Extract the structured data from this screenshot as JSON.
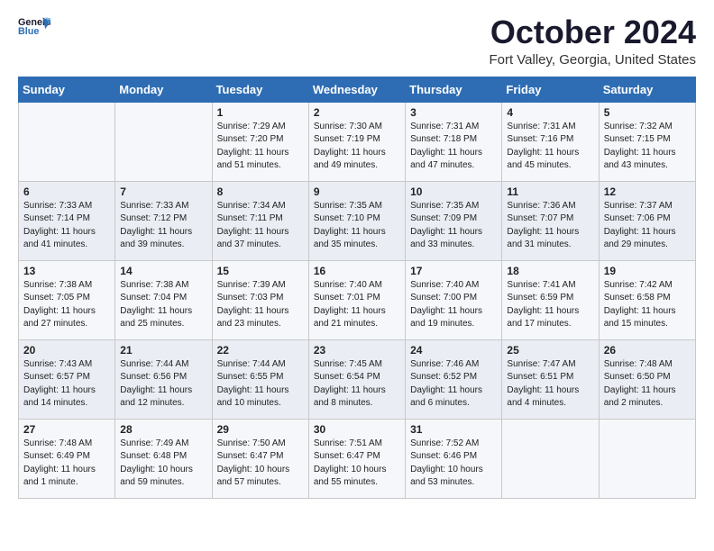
{
  "logo": {
    "line1": "General",
    "line2": "Blue"
  },
  "title": "October 2024",
  "location": "Fort Valley, Georgia, United States",
  "days_header": [
    "Sunday",
    "Monday",
    "Tuesday",
    "Wednesday",
    "Thursday",
    "Friday",
    "Saturday"
  ],
  "weeks": [
    [
      {
        "num": "",
        "sunrise": "",
        "sunset": "",
        "daylight": ""
      },
      {
        "num": "",
        "sunrise": "",
        "sunset": "",
        "daylight": ""
      },
      {
        "num": "1",
        "sunrise": "Sunrise: 7:29 AM",
        "sunset": "Sunset: 7:20 PM",
        "daylight": "Daylight: 11 hours and 51 minutes."
      },
      {
        "num": "2",
        "sunrise": "Sunrise: 7:30 AM",
        "sunset": "Sunset: 7:19 PM",
        "daylight": "Daylight: 11 hours and 49 minutes."
      },
      {
        "num": "3",
        "sunrise": "Sunrise: 7:31 AM",
        "sunset": "Sunset: 7:18 PM",
        "daylight": "Daylight: 11 hours and 47 minutes."
      },
      {
        "num": "4",
        "sunrise": "Sunrise: 7:31 AM",
        "sunset": "Sunset: 7:16 PM",
        "daylight": "Daylight: 11 hours and 45 minutes."
      },
      {
        "num": "5",
        "sunrise": "Sunrise: 7:32 AM",
        "sunset": "Sunset: 7:15 PM",
        "daylight": "Daylight: 11 hours and 43 minutes."
      }
    ],
    [
      {
        "num": "6",
        "sunrise": "Sunrise: 7:33 AM",
        "sunset": "Sunset: 7:14 PM",
        "daylight": "Daylight: 11 hours and 41 minutes."
      },
      {
        "num": "7",
        "sunrise": "Sunrise: 7:33 AM",
        "sunset": "Sunset: 7:12 PM",
        "daylight": "Daylight: 11 hours and 39 minutes."
      },
      {
        "num": "8",
        "sunrise": "Sunrise: 7:34 AM",
        "sunset": "Sunset: 7:11 PM",
        "daylight": "Daylight: 11 hours and 37 minutes."
      },
      {
        "num": "9",
        "sunrise": "Sunrise: 7:35 AM",
        "sunset": "Sunset: 7:10 PM",
        "daylight": "Daylight: 11 hours and 35 minutes."
      },
      {
        "num": "10",
        "sunrise": "Sunrise: 7:35 AM",
        "sunset": "Sunset: 7:09 PM",
        "daylight": "Daylight: 11 hours and 33 minutes."
      },
      {
        "num": "11",
        "sunrise": "Sunrise: 7:36 AM",
        "sunset": "Sunset: 7:07 PM",
        "daylight": "Daylight: 11 hours and 31 minutes."
      },
      {
        "num": "12",
        "sunrise": "Sunrise: 7:37 AM",
        "sunset": "Sunset: 7:06 PM",
        "daylight": "Daylight: 11 hours and 29 minutes."
      }
    ],
    [
      {
        "num": "13",
        "sunrise": "Sunrise: 7:38 AM",
        "sunset": "Sunset: 7:05 PM",
        "daylight": "Daylight: 11 hours and 27 minutes."
      },
      {
        "num": "14",
        "sunrise": "Sunrise: 7:38 AM",
        "sunset": "Sunset: 7:04 PM",
        "daylight": "Daylight: 11 hours and 25 minutes."
      },
      {
        "num": "15",
        "sunrise": "Sunrise: 7:39 AM",
        "sunset": "Sunset: 7:03 PM",
        "daylight": "Daylight: 11 hours and 23 minutes."
      },
      {
        "num": "16",
        "sunrise": "Sunrise: 7:40 AM",
        "sunset": "Sunset: 7:01 PM",
        "daylight": "Daylight: 11 hours and 21 minutes."
      },
      {
        "num": "17",
        "sunrise": "Sunrise: 7:40 AM",
        "sunset": "Sunset: 7:00 PM",
        "daylight": "Daylight: 11 hours and 19 minutes."
      },
      {
        "num": "18",
        "sunrise": "Sunrise: 7:41 AM",
        "sunset": "Sunset: 6:59 PM",
        "daylight": "Daylight: 11 hours and 17 minutes."
      },
      {
        "num": "19",
        "sunrise": "Sunrise: 7:42 AM",
        "sunset": "Sunset: 6:58 PM",
        "daylight": "Daylight: 11 hours and 15 minutes."
      }
    ],
    [
      {
        "num": "20",
        "sunrise": "Sunrise: 7:43 AM",
        "sunset": "Sunset: 6:57 PM",
        "daylight": "Daylight: 11 hours and 14 minutes."
      },
      {
        "num": "21",
        "sunrise": "Sunrise: 7:44 AM",
        "sunset": "Sunset: 6:56 PM",
        "daylight": "Daylight: 11 hours and 12 minutes."
      },
      {
        "num": "22",
        "sunrise": "Sunrise: 7:44 AM",
        "sunset": "Sunset: 6:55 PM",
        "daylight": "Daylight: 11 hours and 10 minutes."
      },
      {
        "num": "23",
        "sunrise": "Sunrise: 7:45 AM",
        "sunset": "Sunset: 6:54 PM",
        "daylight": "Daylight: 11 hours and 8 minutes."
      },
      {
        "num": "24",
        "sunrise": "Sunrise: 7:46 AM",
        "sunset": "Sunset: 6:52 PM",
        "daylight": "Daylight: 11 hours and 6 minutes."
      },
      {
        "num": "25",
        "sunrise": "Sunrise: 7:47 AM",
        "sunset": "Sunset: 6:51 PM",
        "daylight": "Daylight: 11 hours and 4 minutes."
      },
      {
        "num": "26",
        "sunrise": "Sunrise: 7:48 AM",
        "sunset": "Sunset: 6:50 PM",
        "daylight": "Daylight: 11 hours and 2 minutes."
      }
    ],
    [
      {
        "num": "27",
        "sunrise": "Sunrise: 7:48 AM",
        "sunset": "Sunset: 6:49 PM",
        "daylight": "Daylight: 11 hours and 1 minute."
      },
      {
        "num": "28",
        "sunrise": "Sunrise: 7:49 AM",
        "sunset": "Sunset: 6:48 PM",
        "daylight": "Daylight: 10 hours and 59 minutes."
      },
      {
        "num": "29",
        "sunrise": "Sunrise: 7:50 AM",
        "sunset": "Sunset: 6:47 PM",
        "daylight": "Daylight: 10 hours and 57 minutes."
      },
      {
        "num": "30",
        "sunrise": "Sunrise: 7:51 AM",
        "sunset": "Sunset: 6:47 PM",
        "daylight": "Daylight: 10 hours and 55 minutes."
      },
      {
        "num": "31",
        "sunrise": "Sunrise: 7:52 AM",
        "sunset": "Sunset: 6:46 PM",
        "daylight": "Daylight: 10 hours and 53 minutes."
      },
      {
        "num": "",
        "sunrise": "",
        "sunset": "",
        "daylight": ""
      },
      {
        "num": "",
        "sunrise": "",
        "sunset": "",
        "daylight": ""
      }
    ]
  ]
}
